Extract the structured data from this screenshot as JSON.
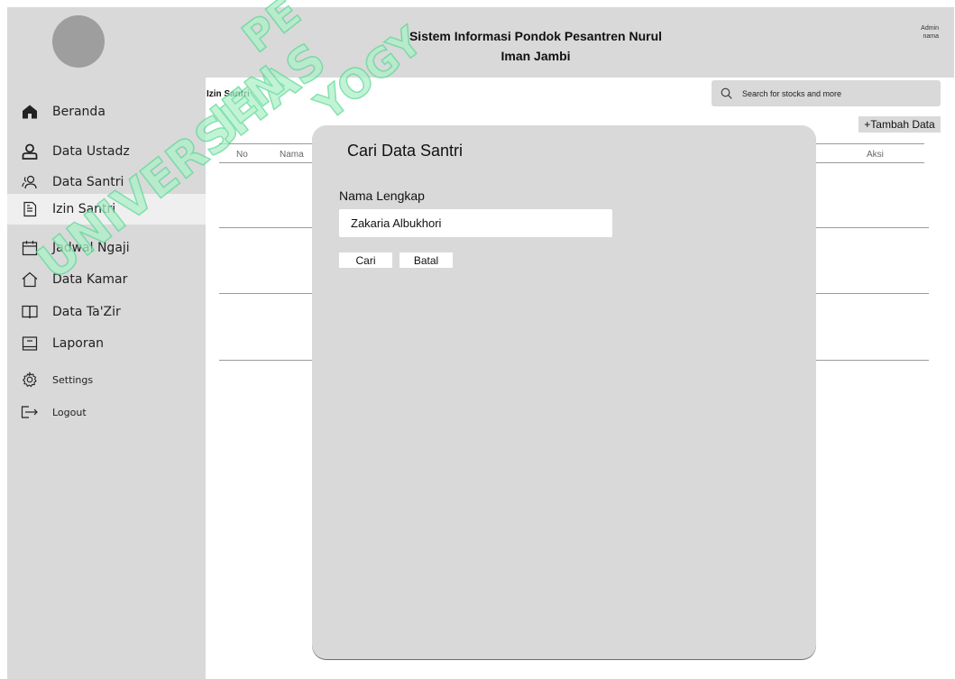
{
  "header": {
    "title_line1": "Sistem Informasi Pondok Pesantren Nurul",
    "title_line2": "Iman Jambi",
    "admin_line1": "Admin",
    "admin_line2": "nama"
  },
  "sidebar": {
    "items": [
      {
        "label": "Beranda",
        "icon": "home-icon"
      },
      {
        "label": "Data Ustadz",
        "icon": "user-icon"
      },
      {
        "label": "Data Santri",
        "icon": "users-icon"
      },
      {
        "label": "Izin Santri",
        "icon": "document-icon",
        "active": true
      },
      {
        "label": "Jadwal Ngaji",
        "icon": "calendar-icon"
      },
      {
        "label": "Data Kamar",
        "icon": "house-outline-icon"
      },
      {
        "label": "Data Ta'Zir",
        "icon": "book-icon"
      },
      {
        "label": "Laporan",
        "icon": "report-icon"
      },
      {
        "label": "Settings",
        "icon": "gear-icon"
      },
      {
        "label": "Logout",
        "icon": "logout-icon"
      }
    ]
  },
  "main": {
    "title": "Izin Santri",
    "search_placeholder": "Search for stocks and more",
    "add_button": "+Tambah Data",
    "columns": {
      "no": "No",
      "nama": "Nama",
      "aksi": "Aksi"
    }
  },
  "modal": {
    "title": "Cari Data Santri",
    "field_label": "Nama Lengkap",
    "field_value": "Zakaria Albukhori",
    "search_button": "Cari",
    "cancel_button": "Batal"
  },
  "watermark": {
    "text_outer": "PERPUSTAKAAN UNIVERSITAS JENDERAL ACHMAD YANI YOGYAKARTA",
    "color": "#7fe3ad"
  },
  "colors": {
    "panel": "#d9d9d9",
    "active_item": "#efefef",
    "avatar": "#9e9e9e"
  }
}
